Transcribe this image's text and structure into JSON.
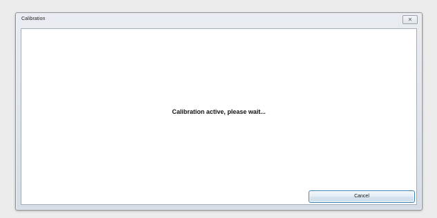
{
  "window": {
    "title": "Calibration",
    "close_glyph": "✕",
    "close_icon": "close-icon"
  },
  "dialog": {
    "message": "Calibration active, please wait...",
    "cancel_label": "Cancel"
  },
  "colors": {
    "background": "#ececec",
    "button_border": "#3c7fb1"
  }
}
